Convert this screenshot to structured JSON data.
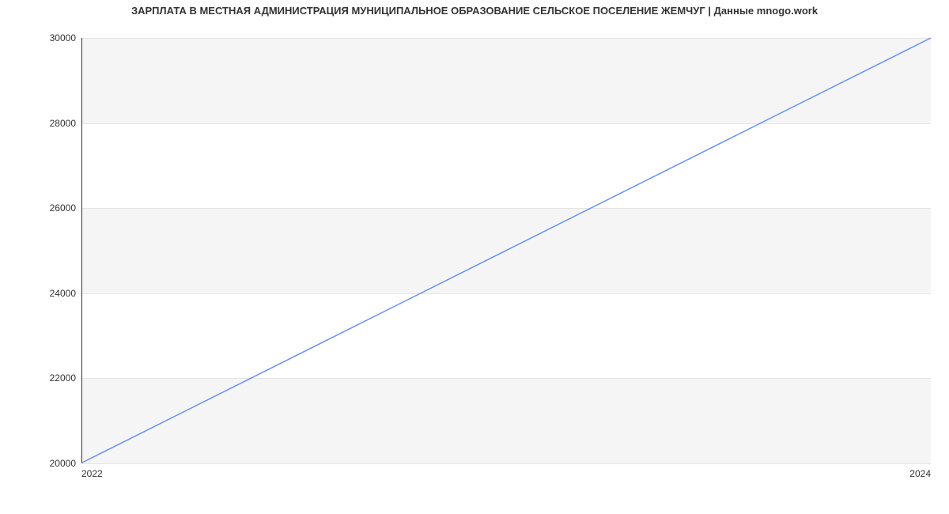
{
  "chart_data": {
    "type": "line",
    "title": "ЗАРПЛАТА В МЕСТНАЯ АДМИНИСТРАЦИЯ МУНИЦИПАЛЬНОЕ ОБРАЗОВАНИЕ СЕЛЬСКОЕ ПОСЕЛЕНИЕ ЖЕМЧУГ | Данные mnogo.work",
    "x": [
      2022,
      2024
    ],
    "values": [
      20000,
      30000
    ],
    "xlabel": "",
    "ylabel": "",
    "xlim": [
      2022,
      2024
    ],
    "ylim": [
      20000,
      30000
    ],
    "y_ticks": [
      20000,
      22000,
      24000,
      26000,
      28000,
      30000
    ],
    "x_ticks": [
      2022,
      2024
    ],
    "grid_bands": [
      {
        "from": 20000,
        "to": 22000
      },
      {
        "from": 24000,
        "to": 26000
      },
      {
        "from": 28000,
        "to": 30000
      }
    ]
  }
}
